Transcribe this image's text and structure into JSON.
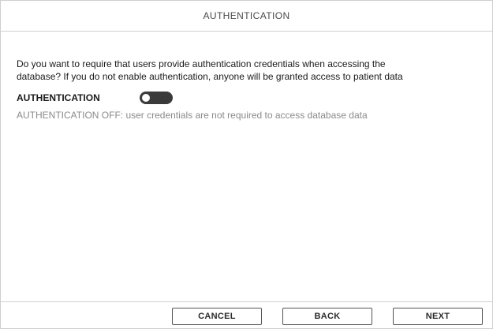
{
  "header": {
    "title": "AUTHENTICATION"
  },
  "main": {
    "question_line1": "Do you want to require that users provide authentication credentials when accessing the",
    "question_line2": "database? If you do not enable authentication, anyone will be granted access to patient data",
    "setting_label": "AUTHENTICATION",
    "toggle_state": "off",
    "status_text": "AUTHENTICATION OFF: user credentials are not required to access database data"
  },
  "footer": {
    "cancel_label": "CANCEL",
    "back_label": "BACK",
    "next_label": "NEXT"
  }
}
